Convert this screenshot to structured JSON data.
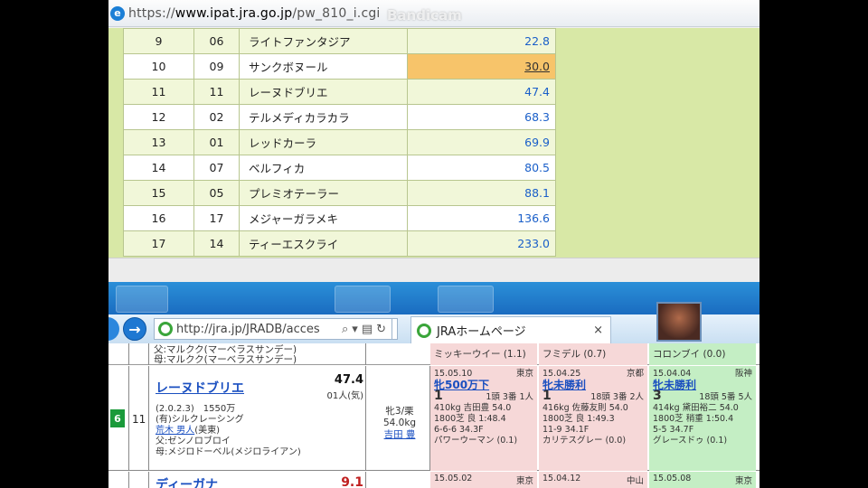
{
  "upper_window": {
    "url_scheme": "https://",
    "url_host": "www.ipat.jra.go.jp",
    "url_path": "/pw_810_i.cgi",
    "watermark": "Bandicam",
    "odds_rows": [
      {
        "rank": "9",
        "num": "06",
        "name": "ライトファンタジア",
        "odds": "22.8",
        "highlight": false
      },
      {
        "rank": "10",
        "num": "09",
        "name": "サンクボヌール",
        "odds": "30.0",
        "highlight": true
      },
      {
        "rank": "11",
        "num": "11",
        "name": "レーヌドブリエ",
        "odds": "47.4",
        "highlight": false
      },
      {
        "rank": "12",
        "num": "02",
        "name": "テルメディカラカラ",
        "odds": "68.3",
        "highlight": false
      },
      {
        "rank": "13",
        "num": "01",
        "name": "レッドカーラ",
        "odds": "69.9",
        "highlight": false
      },
      {
        "rank": "14",
        "num": "07",
        "name": "ベルフィカ",
        "odds": "80.5",
        "highlight": false
      },
      {
        "rank": "15",
        "num": "05",
        "name": "プレミオテーラー",
        "odds": "88.1",
        "highlight": false
      },
      {
        "rank": "16",
        "num": "17",
        "name": "メジャーガラメキ",
        "odds": "136.6",
        "highlight": false
      },
      {
        "rank": "17",
        "num": "14",
        "name": "ティーエスクライ",
        "odds": "233.0",
        "highlight": false
      }
    ],
    "highlight_color": "#f7c46a",
    "background_color": "#d8e8a6"
  },
  "lower_window": {
    "address_url": "http://jra.jp/JRADB/acces",
    "tab_title": "JRAホームページ",
    "tab_close": "×",
    "top_row": {
      "sire_line1": "父:マルクク(マーベラスサンデー)",
      "sire_line2": "母:マルクク(マーベラスサンデー)",
      "prev1": "ミッキーウイー (1.1)",
      "prev2": "フミデル (0.7)",
      "prev3": "コロンブイ (0.0)"
    },
    "horse": {
      "post": "6",
      "number": "11",
      "name": "レーヌドブリエ",
      "odds": "47.4",
      "popularity": "01人(気)",
      "info_line1": "(2.0.2.3)　1550万",
      "info_line2": "(有)シルクレーシング",
      "trainer": "荒木 男人",
      "trainer_region": "(美東)",
      "sire": "父:ゼンノロブロイ",
      "dam": "母:メジロドーベル(メジロライアン)",
      "sex_age": "牝3/栗",
      "weight": "54.0kg",
      "jockey": "吉田 豊"
    },
    "prev_races": [
      {
        "date": "15.05.10",
        "venue": "東京",
        "race": "牝500万下",
        "place": "1",
        "detail1": "1頭 3番 1人",
        "detail2": "410kg 吉田豊 54.0",
        "detail3": "1800芝 良 1:48.4",
        "detail4": "6-6-6 34.3F",
        "winner": "パワーウーマン (0.1)",
        "color": "pink"
      },
      {
        "date": "15.04.25",
        "venue": "京都",
        "race": "牝未勝利",
        "place": "1",
        "detail1": "18頭 3番 2人",
        "detail2": "416kg 佐藤友則 54.0",
        "detail3": "1800芝 良 1:49.3",
        "detail4": "11-9 34.1F",
        "winner": "カリテスグレー (0.0)",
        "color": "pink"
      },
      {
        "date": "15.04.04",
        "venue": "阪神",
        "race": "牝未勝利",
        "place": "3",
        "detail1": "18頭 5番 5人",
        "detail2": "414kg 黛田裕二 54.0",
        "detail3": "1800芝 稍重 1:50.4",
        "detail4": "5-5 34.7F",
        "winner": "グレースドゥ (0.1)",
        "color": "green"
      }
    ],
    "next_row": {
      "name": "ディーガナ",
      "odds": "9.1",
      "prev1_date": "15.05.02",
      "prev1_venue": "東京",
      "prev2_date": "15.04.12",
      "prev2_venue": "中山",
      "prev3_date": "15.05.08",
      "prev3_venue": "東京"
    }
  }
}
